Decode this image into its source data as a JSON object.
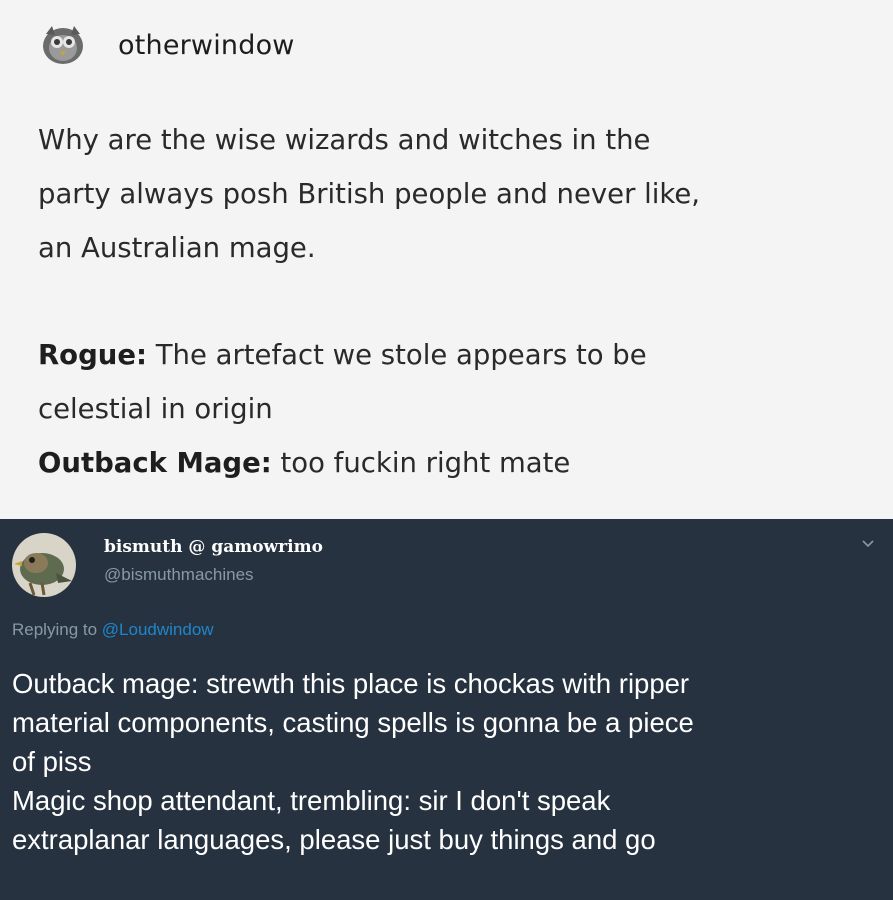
{
  "post": {
    "username": "otherwindow",
    "body_lines": [
      "Why are the wise wizards and witches in the",
      "party always posh British people and never like,",
      "an Australian mage."
    ],
    "dialogue": [
      {
        "speaker": "Rogue:",
        "lines": [
          " The artefact we stole appears to be",
          "celestial in origin"
        ]
      },
      {
        "speaker": "Outback Mage:",
        "lines": [
          " too fuckin right mate"
        ]
      }
    ]
  },
  "tweet": {
    "display_name": "bismuth @ gamowrimo",
    "handle": "@bismuthmachines",
    "reply_prefix": "Replying to",
    "reply_mention": "@Loudwindow",
    "text_lines": [
      "Outback mage: strewth this place is chockas with ripper",
      "material components, casting spells is gonna be a piece",
      "of piss",
      "Magic shop attendant, trembling: sir I don't speak",
      "extraplanar languages, please just buy things and go"
    ],
    "colors": {
      "background": "#273240",
      "secondary_text": "#8899a6",
      "link": "#1d9bf0"
    },
    "icons": {
      "menu": "chevron-down-icon"
    }
  }
}
